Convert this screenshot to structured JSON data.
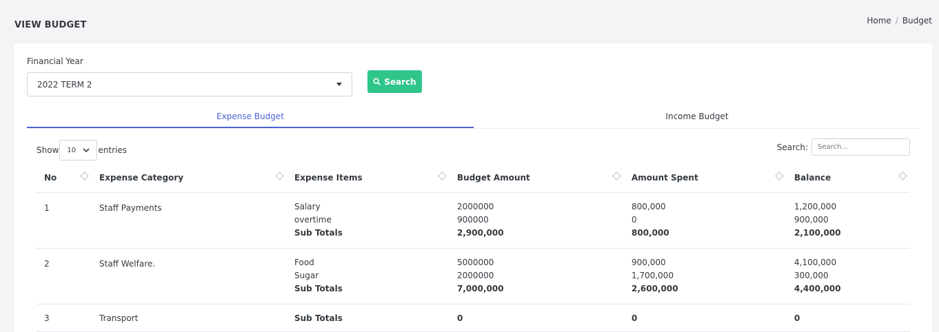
{
  "page": {
    "title": "VIEW BUDGET"
  },
  "breadcrumb": {
    "home": "Home",
    "separator": "/",
    "current": "Budget"
  },
  "filter": {
    "label": "Financial Year",
    "selected": "2022 TERM 2",
    "search_button": "Search"
  },
  "tabs": [
    {
      "label": "Expense Budget",
      "active": true
    },
    {
      "label": "Income Budget",
      "active": false
    }
  ],
  "table_controls": {
    "show_label": "Show",
    "page_length": "10",
    "entries_label": "entries",
    "search_label": "Search:",
    "search_placeholder": "Search..."
  },
  "table": {
    "headers": [
      "No",
      "Expense Category",
      "Expense Items",
      "Budget Amount",
      "Amount Spent",
      "Balance"
    ],
    "rows": [
      {
        "no": "1",
        "category": "Staff Payments",
        "items": [
          "Salary",
          "overtime"
        ],
        "budget": [
          "2000000",
          "900000"
        ],
        "spent": [
          "800,000",
          "0"
        ],
        "balance": [
          "1,200,000",
          "900,000"
        ],
        "subtotal": {
          "label": "Sub Totals",
          "budget": "2,900,000",
          "spent": "800,000",
          "balance": "2,100,000"
        }
      },
      {
        "no": "2",
        "category": "Staff Welfare.",
        "items": [
          "Food",
          "Sugar"
        ],
        "budget": [
          "5000000",
          "2000000"
        ],
        "spent": [
          "900,000",
          "1,700,000"
        ],
        "balance": [
          "4,100,000",
          "300,000"
        ],
        "subtotal": {
          "label": "Sub Totals",
          "budget": "7,000,000",
          "spent": "2,600,000",
          "balance": "4,400,000"
        }
      },
      {
        "no": "3",
        "category": "Transport",
        "items": [],
        "budget": [],
        "spent": [],
        "balance": [],
        "subtotal": {
          "label": "Sub Totals",
          "budget": "0",
          "spent": "0",
          "balance": "0"
        }
      }
    ]
  },
  "colors": {
    "accent": "#4b63d7",
    "search_button": "#2fc58b"
  }
}
